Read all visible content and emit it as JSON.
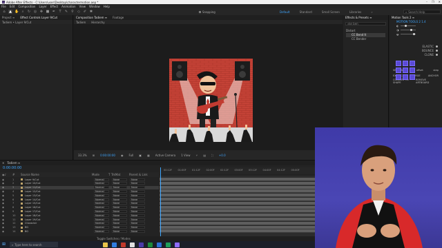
{
  "window": {
    "title": "Adobe After Effects - C:\\Users\\user\\Desktop\\charactermotion.aep *",
    "logo": "Ae",
    "controls": [
      "–",
      "❐",
      "✕"
    ]
  },
  "menu": [
    "File",
    "Edit",
    "Composition",
    "Layer",
    "Effect",
    "Animation",
    "View",
    "Window",
    "Help"
  ],
  "toolbar": {
    "snapping_label": "Snapping",
    "workspaces": [
      "Default",
      "Standard",
      "Small Screen",
      "Libraries"
    ],
    "workspace_arrow": "»",
    "search_placeholder": "Search Help"
  },
  "project_panel": {
    "tabs": [
      "Project ≡",
      "Effect Controls Layer 9/Cut"
    ],
    "subtitle": "Tadiem • Layer 9/Cut"
  },
  "composition_panel": {
    "tabs": [
      "Composition Tadiem ≡",
      "Footage"
    ],
    "subtabs": [
      "Tadiem",
      "Hierarchy"
    ],
    "footer": {
      "zoom": "33.3%",
      "timecode": "0:00:00:00",
      "resolution": "Full",
      "camera": "Active Camera",
      "views": "1 View",
      "exposure": "+0.0"
    }
  },
  "effects_panel": {
    "title": "Effects & Presets ≡",
    "search_value": "ke ben",
    "tree": {
      "root": "Distort",
      "selected": "CC Bend It",
      "child": "CC Bender"
    }
  },
  "motion_panel": {
    "title": "Motion Tools 2 ≡",
    "section_label": "MOTION TOOLS 2 1.4",
    "options": [
      "ELASTIC",
      "BOUNCE",
      "CLONE"
    ],
    "sequence_label": "SEQUENCE",
    "sequence_options": [
      "offset",
      "step"
    ],
    "buttons_row1": [
      "EXTRACT",
      "MERGE",
      "ANCHOR"
    ],
    "buttons_row2": [
      "CONVERT TO SHAPE",
      "REMOVE ARTBOARD"
    ]
  },
  "timeline": {
    "tab": "Tadiem ≡",
    "timecode": "0:00:00:00",
    "columns": [
      "#",
      "Source Name",
      "Mode",
      "T",
      "TrkMat",
      "Parent & Link"
    ],
    "layers": [
      {
        "num": "1",
        "name": "Layer 9/Cut",
        "mode": "Normal",
        "trk": "None",
        "parent": "None",
        "selected": false
      },
      {
        "num": "2",
        "name": "Layer 10/Cut",
        "mode": "Normal",
        "trk": "None",
        "parent": "None",
        "selected": false
      },
      {
        "num": "3",
        "name": "Layer 11/Cut",
        "mode": "Normal",
        "trk": "None",
        "parent": "None",
        "selected": true
      },
      {
        "num": "4",
        "name": "Layer 12/Cut",
        "mode": "Normal",
        "trk": "None",
        "parent": "None",
        "selected": false
      },
      {
        "num": "5",
        "name": "Layer 13/Cut",
        "mode": "Normal",
        "trk": "None",
        "parent": "None",
        "selected": false
      },
      {
        "num": "6",
        "name": "Layer 14/Cut",
        "mode": "Normal",
        "trk": "None",
        "parent": "None",
        "selected": false
      },
      {
        "num": "7",
        "name": "Layer 15/Cut",
        "mode": "Normal",
        "trk": "None",
        "parent": "None",
        "selected": false
      },
      {
        "num": "8",
        "name": "Layer 16/Cut",
        "mode": "Normal",
        "trk": "None",
        "parent": "None",
        "selected": false
      },
      {
        "num": "9",
        "name": "Layer 17/Cut",
        "mode": "Normal",
        "trk": "None",
        "parent": "None",
        "selected": false
      },
      {
        "num": "10",
        "name": "Layer 18/Cut",
        "mode": "Normal",
        "trk": "None",
        "parent": "None",
        "selected": false
      },
      {
        "num": "11",
        "name": "Layer 19/Cut",
        "mode": "Normal",
        "trk": "None",
        "parent": "None",
        "selected": false
      },
      {
        "num": "12",
        "name": "Character",
        "mode": "Normal",
        "trk": "None",
        "parent": "None",
        "selected": false
      },
      {
        "num": "13",
        "name": "BG",
        "mode": "Normal",
        "trk": "None",
        "parent": "None",
        "selected": false
      },
      {
        "num": "14",
        "name": "BG",
        "mode": "Normal",
        "trk": "None",
        "parent": "None",
        "selected": false
      }
    ],
    "ruler_ticks": [
      "00:12F",
      "01:00F",
      "01:12F",
      "02:00F",
      "02:12F",
      "03:00F",
      "03:12F",
      "04:00F",
      "04:12F",
      "05:00F"
    ],
    "footer": "Toggle Switches / Modes"
  },
  "taskbar": {
    "search_placeholder": "Type here to search",
    "apps": [
      "#e8c44a",
      "#2f7de1",
      "#c0392b",
      "#e0e0e0",
      "#4a3aa8",
      "#1c8a3a",
      "#2b6fd6",
      "#1e9e5a",
      "#8d6cff"
    ]
  },
  "colors": {
    "accent": "#3ea6ff",
    "brick": "#c44236",
    "webcam_bg": "#4a46b4",
    "motion_purple": "#5b4bd6"
  }
}
